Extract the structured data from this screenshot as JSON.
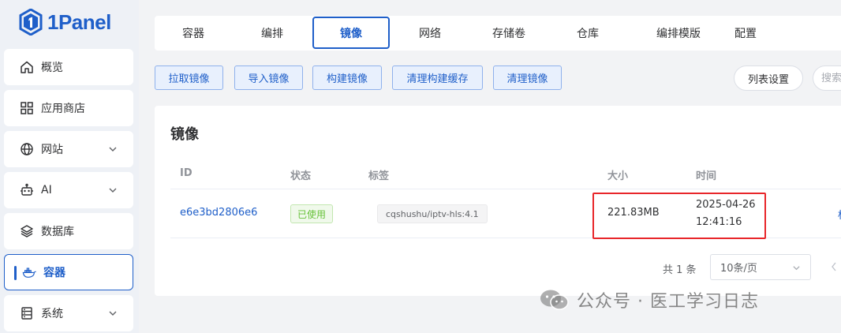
{
  "app": {
    "logo_text": "1Panel"
  },
  "sidebar": {
    "items": [
      {
        "label": "概览",
        "icon": "home-icon",
        "has_chevron": false
      },
      {
        "label": "应用商店",
        "icon": "grid-icon",
        "has_chevron": false
      },
      {
        "label": "网站",
        "icon": "globe-icon",
        "has_chevron": true
      },
      {
        "label": "AI",
        "icon": "robot-icon",
        "has_chevron": true
      },
      {
        "label": "数据库",
        "icon": "layers-icon",
        "has_chevron": false
      },
      {
        "label": "容器",
        "icon": "docker-icon",
        "has_chevron": false,
        "active": true
      },
      {
        "label": "系统",
        "icon": "server-icon",
        "has_chevron": true
      }
    ]
  },
  "tabs": [
    {
      "label": "容器"
    },
    {
      "label": "编排"
    },
    {
      "label": "镜像",
      "active": true
    },
    {
      "label": "网络"
    },
    {
      "label": "存储卷"
    },
    {
      "label": "仓库"
    },
    {
      "label": "编排模版"
    },
    {
      "label": "配置"
    }
  ],
  "actions": {
    "pull": "拉取镜像",
    "import": "导入镜像",
    "build": "构建镜像",
    "clear_build_cache": "清理构建缓存",
    "clear_images": "清理镜像",
    "column_settings": "列表设置",
    "search_placeholder": "搜索"
  },
  "card": {
    "title": "镜像"
  },
  "table": {
    "columns": {
      "id": "ID",
      "status": "状态",
      "tags": "标签",
      "size": "大小",
      "time": "时间"
    },
    "rows": [
      {
        "id": "e6e3bd2806e6",
        "status": "已使用",
        "tag": "cqshushu/iptv-hls:4.1",
        "size": "221.83MB",
        "date": "2025-04-26",
        "clock": "12:41:16",
        "op": "标"
      }
    ]
  },
  "pagination": {
    "total": "共 1 条",
    "page_size": "10条/页"
  },
  "watermark": {
    "text": "公众号 · 医工学习日志"
  },
  "colors": {
    "accent": "#1f5fc9",
    "highlight": "#e8262a",
    "success": "#67c23a"
  }
}
